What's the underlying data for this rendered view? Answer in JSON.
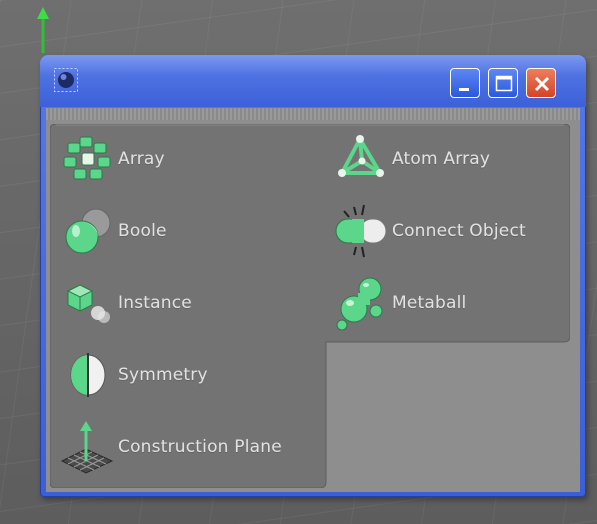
{
  "window": {
    "title": "",
    "controls": [
      "minimize",
      "maximize",
      "close"
    ]
  },
  "panel": {
    "left_items": [
      {
        "label": "Array",
        "icon": "array-icon"
      },
      {
        "label": "Boole",
        "icon": "boole-icon"
      },
      {
        "label": "Instance",
        "icon": "instance-icon"
      },
      {
        "label": "Symmetry",
        "icon": "symmetry-icon"
      },
      {
        "label": "Construction Plane",
        "icon": "construction-plane-icon"
      }
    ],
    "right_items": [
      {
        "label": "Atom Array",
        "icon": "atom-array-icon"
      },
      {
        "label": "Connect Object",
        "icon": "connect-object-icon"
      },
      {
        "label": "Metaball",
        "icon": "metaball-icon"
      }
    ]
  },
  "colors": {
    "titlebar": "#3c60d8",
    "close_button": "#d44426",
    "icon_green": "#5bd68a",
    "panel_background": "#727272",
    "label_text": "#e2e2e2"
  }
}
